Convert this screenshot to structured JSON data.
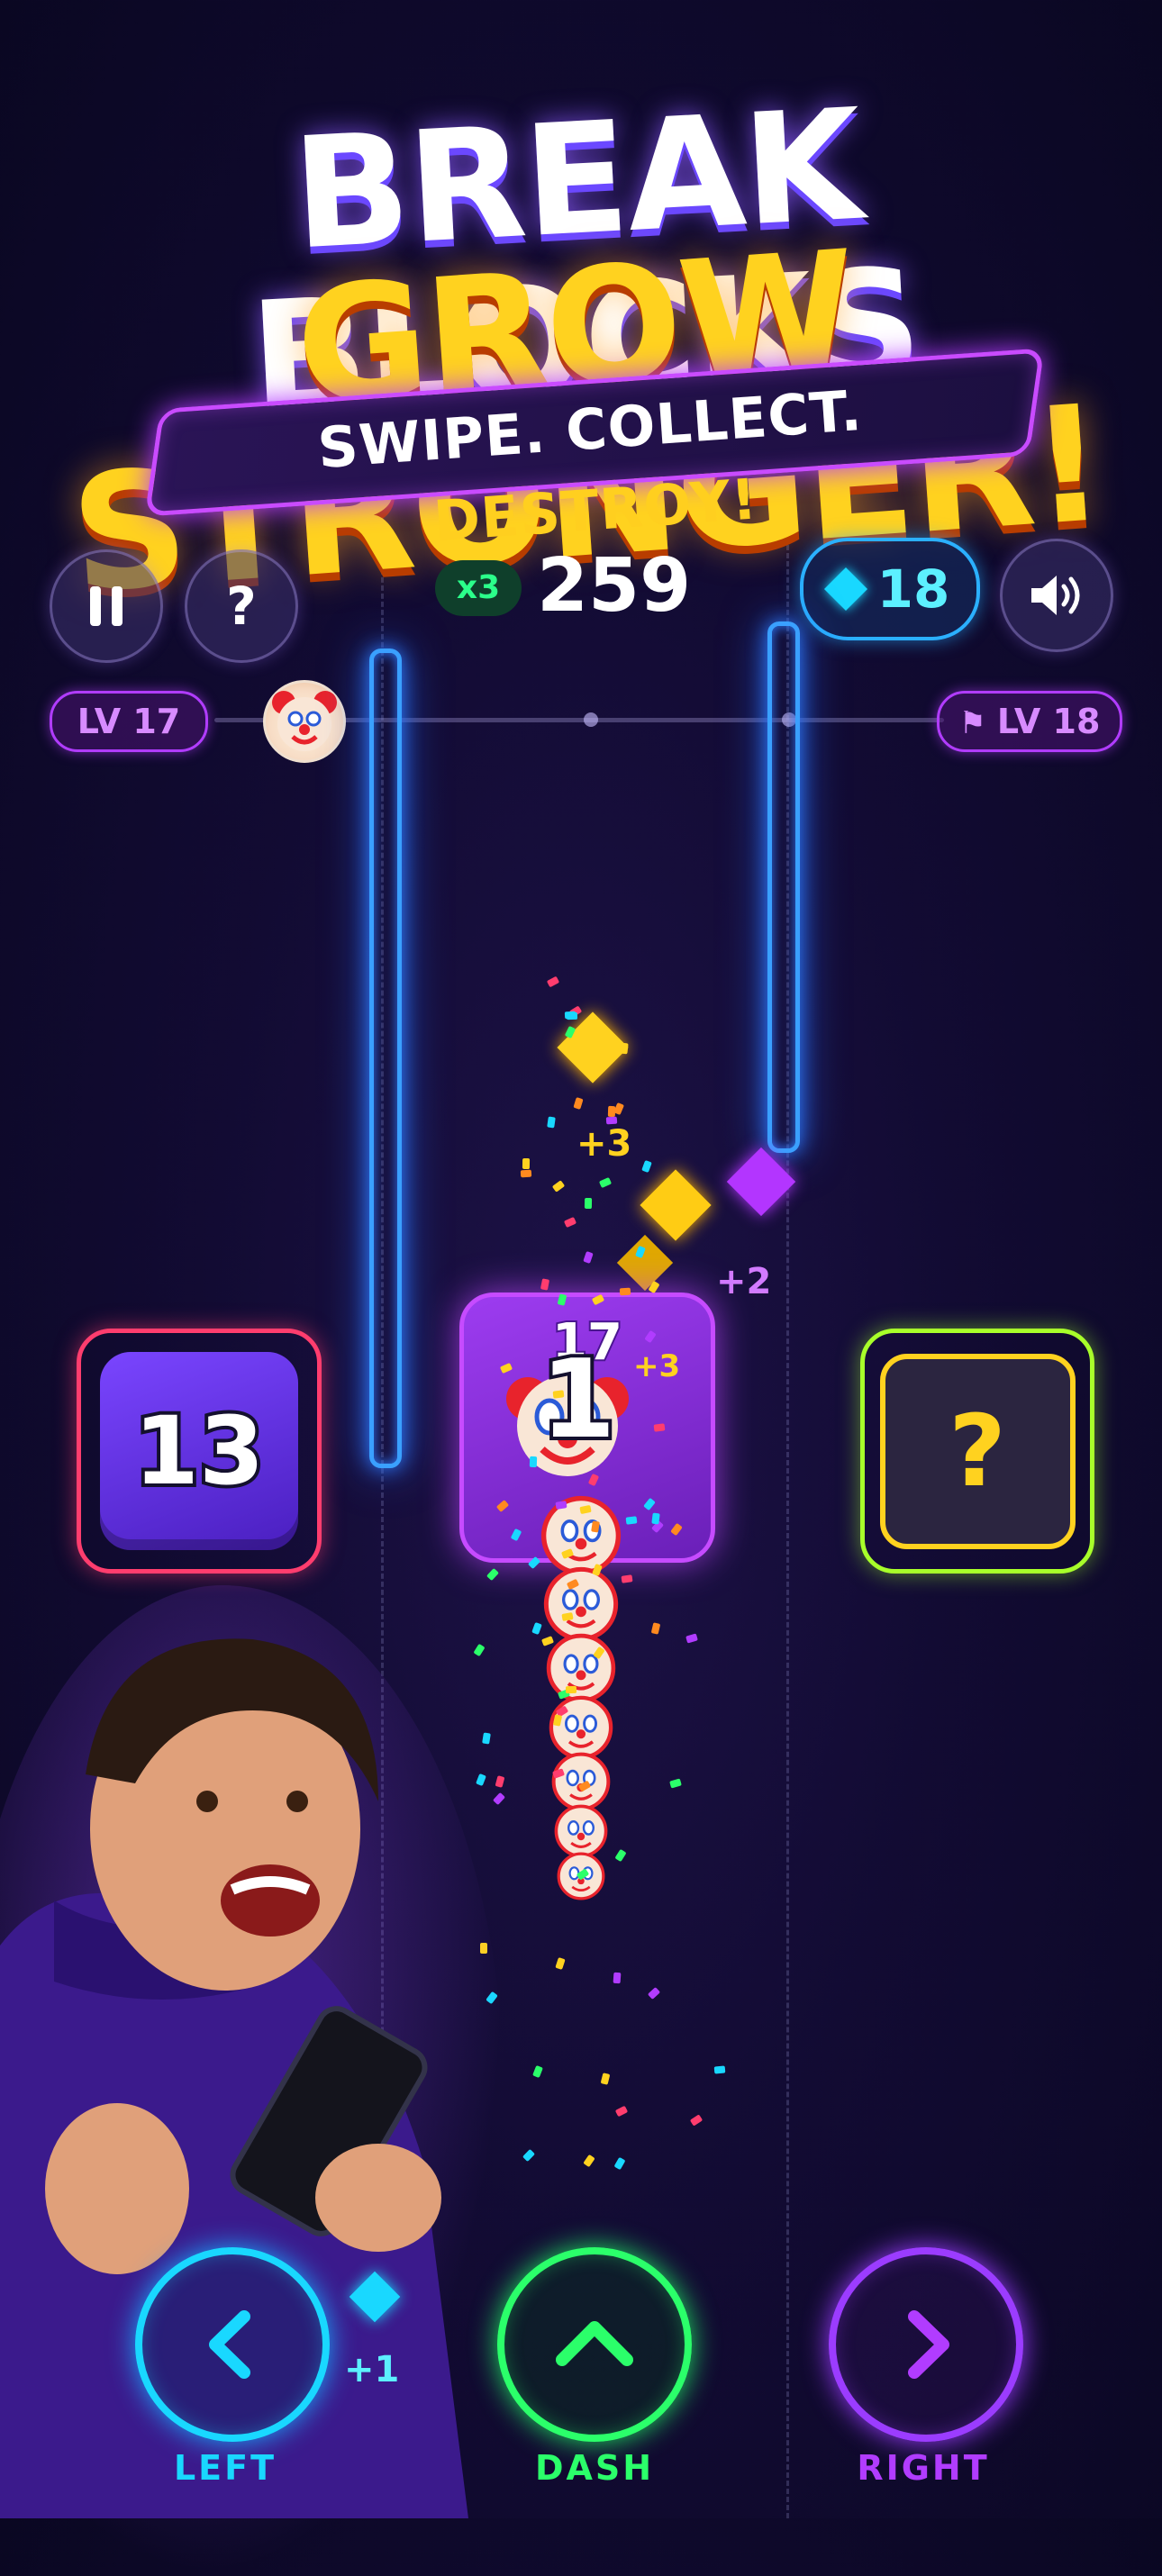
{
  "title": {
    "line1": "BREAK BLOCKS",
    "line2": "GROW STRONGER!"
  },
  "tagline": {
    "part1": "SWIPE. COLLECT. ",
    "part2": "DESTROY!"
  },
  "hud": {
    "multiplier": "x3",
    "score": "259",
    "gems": "18",
    "pause_icon": "pause-icon",
    "help_label": "?",
    "sound_icon": "speaker-icon"
  },
  "level": {
    "current": "LV 17",
    "next": "LV 18",
    "progress": 0.12
  },
  "blocks": [
    {
      "value": "13",
      "color": "#5b2bd6",
      "border": "#ff3d6e"
    },
    {
      "value": "17",
      "color": "#8a2fe0",
      "border": "#c64bff"
    },
    {
      "value": "?",
      "color": "#2a1e3c",
      "border": "#a8ff2a"
    }
  ],
  "player": {
    "count": "1"
  },
  "bonuses": {
    "plus3_a": "+3",
    "plus3_b": "+3",
    "plus2": "+2",
    "plus1": "+1"
  },
  "controls": {
    "left": "LEFT",
    "dash": "DASH",
    "right": "RIGHT"
  },
  "colors": {
    "cyan": "#19d8ff",
    "green": "#2bff6a",
    "purple": "#b13cff",
    "gold": "#ffd21f"
  }
}
